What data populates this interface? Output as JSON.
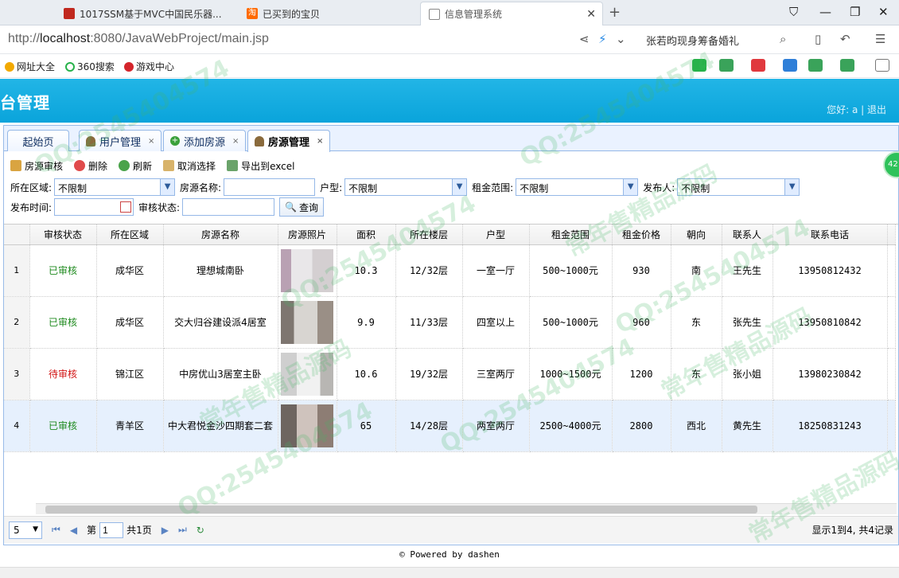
{
  "browser": {
    "tabs": [
      {
        "label": "1017SSM基于MVC中国民乐器..."
      },
      {
        "label": "已买到的宝贝"
      },
      {
        "label": "信息管理系统"
      }
    ],
    "url_prefix": "http://",
    "url_host": "localhost",
    "url_rest": ":8080/JavaWebProject/main.jsp",
    "hot_search": "张若昀现身筹备婚礼",
    "bookmarks": [
      "网址大全",
      "360搜索",
      "游戏中心"
    ]
  },
  "app": {
    "title": "台管理",
    "greeting": "您好: a",
    "logout": "退出",
    "tabs": [
      {
        "label": "起始页"
      },
      {
        "label": "用户管理"
      },
      {
        "label": "添加房源"
      },
      {
        "label": "房源管理"
      }
    ]
  },
  "toolbar": {
    "audit": "房源审核",
    "delete": "删除",
    "refresh": "刷新",
    "unselect": "取消选择",
    "export": "导出到excel"
  },
  "filters": {
    "area_label": "所在区域:",
    "area_value": "不限制",
    "name_label": "房源名称:",
    "type_label": "户型:",
    "type_value": "不限制",
    "rent_label": "租金范围:",
    "rent_value": "不限制",
    "publisher_label": "发布人:",
    "publisher_value": "不限制",
    "time_label": "发布时间:",
    "status_label": "审核状态:",
    "query_button": "查询"
  },
  "grid": {
    "columns": [
      "审核状态",
      "所在区域",
      "房源名称",
      "房源照片",
      "面积",
      "所在楼层",
      "户型",
      "租金范围",
      "租金价格",
      "朝向",
      "联系人",
      "联系电话"
    ],
    "rows": [
      {
        "n": "1",
        "status": "已审核",
        "area": "成华区",
        "name": "理想城南卧",
        "size": "10.3",
        "floor": "12/32层",
        "type": "一室一厅",
        "range": "500~1000元",
        "price": "930",
        "facing": "南",
        "contact": "王先生",
        "phone": "13950812432"
      },
      {
        "n": "2",
        "status": "已审核",
        "area": "成华区",
        "name": "交大归谷建设派4居室",
        "size": "9.9",
        "floor": "11/33层",
        "type": "四室以上",
        "range": "500~1000元",
        "price": "960",
        "facing": "东",
        "contact": "张先生",
        "phone": "13950810842"
      },
      {
        "n": "3",
        "status": "待审核",
        "area": "锦江区",
        "name": "中房优山3居室主卧",
        "size": "10.6",
        "floor": "19/32层",
        "type": "三室两厅",
        "range": "1000~1500元",
        "price": "1200",
        "facing": "东",
        "contact": "张小姐",
        "phone": "13980230842"
      },
      {
        "n": "4",
        "status": "已审核",
        "area": "青羊区",
        "name": "中大君悦金沙四期套二套",
        "size": "65",
        "floor": "14/28层",
        "type": "两室两厅",
        "range": "2500~4000元",
        "price": "2800",
        "facing": "西北",
        "contact": "黄先生",
        "phone": "18250831243"
      }
    ]
  },
  "pager": {
    "page_size": "5",
    "page_prefix": "第",
    "page_value": "1",
    "page_suffix": "共1页",
    "info": "显示1到4, 共4记录"
  },
  "footer": "© Powered by dashen",
  "side_badge": "42",
  "watermark_qq": "QQ:2545404574",
  "watermark_cn": "常年售精品源码"
}
